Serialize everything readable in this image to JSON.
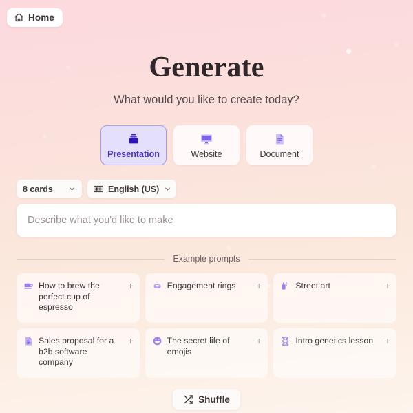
{
  "header": {
    "home_label": "Home",
    "home_icon": "home-icon"
  },
  "hero": {
    "title": "Generate",
    "subtitle": "What would you like to create today?"
  },
  "generation_types": [
    {
      "label": "Presentation",
      "icon": "presentation-stack-icon",
      "selected": true
    },
    {
      "label": "Website",
      "icon": "monitor-icon",
      "selected": false
    },
    {
      "label": "Document",
      "icon": "document-file-icon",
      "selected": false
    }
  ],
  "controls": {
    "card_count": {
      "value": "8 cards",
      "icon": "chevron-down-icon"
    },
    "language": {
      "value": "English (US)",
      "icon": "flag-card-icon",
      "chevron": "chevron-down-icon"
    }
  },
  "prompt": {
    "value": "",
    "placeholder": "Describe what you'd like to make"
  },
  "examples": {
    "divider_label": "Example prompts",
    "add_icon": "plus-icon",
    "items": [
      {
        "text": "How to brew the perfect cup of espresso",
        "icon": "coffee-cup-icon"
      },
      {
        "text": "Engagement rings",
        "icon": "ring-icon"
      },
      {
        "text": "Street art",
        "icon": "spray-can-icon"
      },
      {
        "text": "Sales proposal for a b2b software company",
        "icon": "document-chart-icon"
      },
      {
        "text": "The secret life of emojis",
        "icon": "smiley-icon"
      },
      {
        "text": "Intro genetics lesson",
        "icon": "dna-icon"
      }
    ]
  },
  "shuffle": {
    "label": "Shuffle",
    "icon": "shuffle-arrows-icon"
  },
  "colors": {
    "accent_purple": "#4b32cd",
    "icon_purple": "#9b7ff0",
    "selected_card_bg": "#e4dffb",
    "selected_card_border": "#a99bec",
    "text_primary": "#3d3436",
    "bg_top": "#fcd9dd",
    "bg_bottom": "#fdf4ed"
  }
}
